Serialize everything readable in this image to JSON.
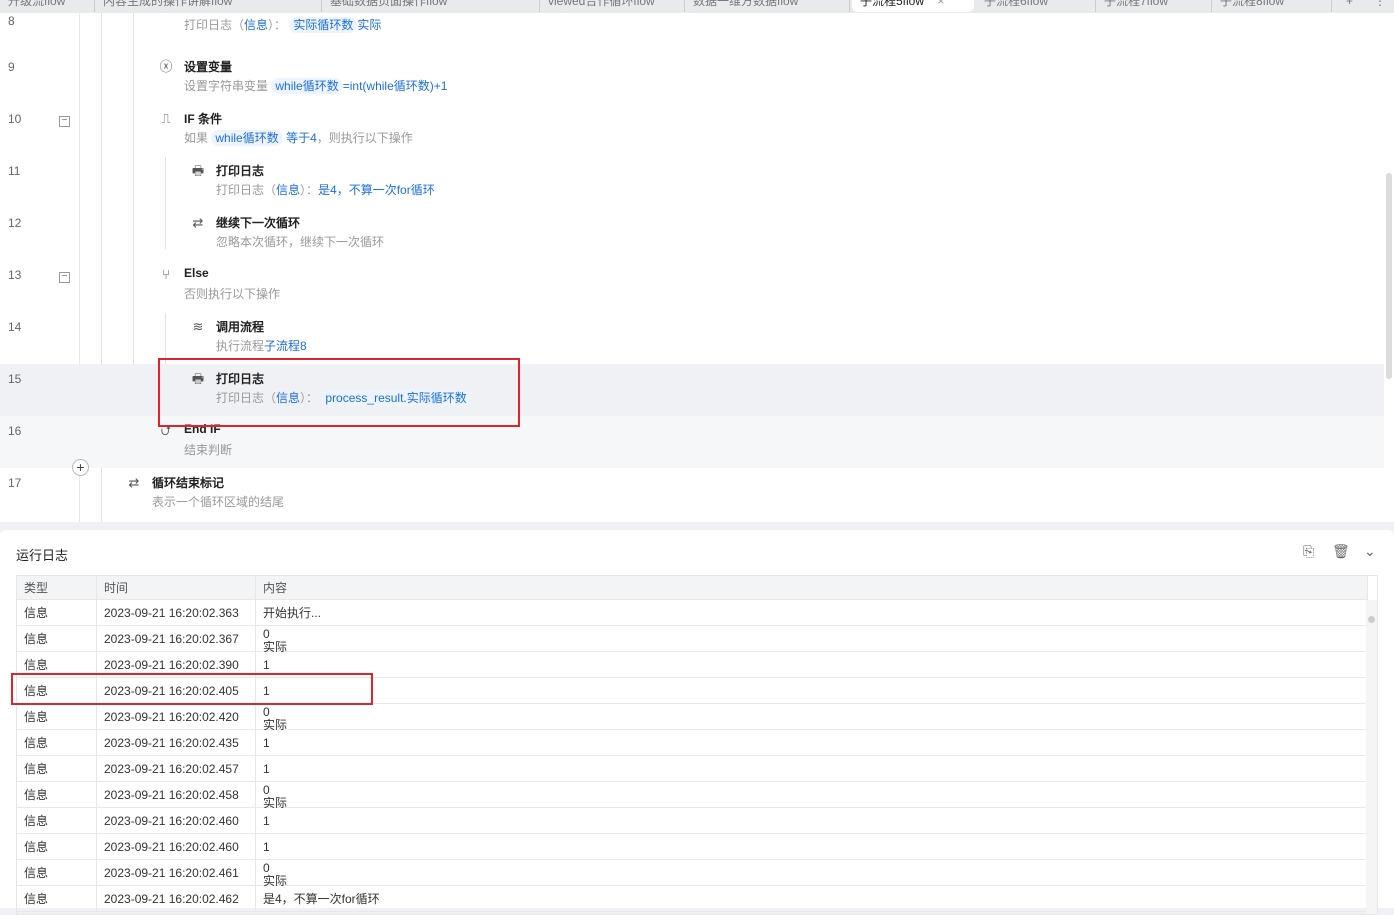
{
  "tabs": [
    {
      "label": "升级流flow"
    },
    {
      "label": "内容生成的操作讲解flow"
    },
    {
      "label": "基础数据页面操作flow"
    },
    {
      "label": "viewed合作循环flow"
    },
    {
      "label": "数据一维方数据flow"
    },
    {
      "label": "子流程5flow",
      "active": true
    },
    {
      "label": "子流程6flow"
    },
    {
      "label": "子流程7flow"
    },
    {
      "label": "子流程8flow"
    }
  ],
  "tab_close": "×",
  "tab_add": "+",
  "tab_more": "⋮",
  "steps": [
    {
      "line": "8",
      "title": "打印日志",
      "desc": "打印日志（",
      "desc_kw": "信息",
      "desc2": "）：",
      "chip": "实际循环数",
      "tail": "实际"
    },
    {
      "line": "9",
      "title": "设置变量",
      "desc": "设置字符串变量",
      "chip": "while循环数",
      "tail": "=int(while循环数)+1"
    },
    {
      "line": "10",
      "title": "IF 条件",
      "desc": "如果",
      "chip": "while循环数",
      "mid": "等于4",
      "tail": "，则执行以下操作",
      "fold": "−"
    },
    {
      "line": "11",
      "title": "打印日志",
      "desc": "打印日志（",
      "desc_kw": "信息",
      "desc2": "）：",
      "tail": "是4，不算一次for循环"
    },
    {
      "line": "12",
      "title": "继续下一次循环",
      "desc": "忽略本次循环，继续下一次循环"
    },
    {
      "line": "13",
      "title": "Else",
      "desc": "否则执行以下操作",
      "fold": "−"
    },
    {
      "line": "14",
      "title": "调用流程",
      "desc": "执行流程",
      "tail": "子流程8"
    },
    {
      "line": "15",
      "title": "打印日志",
      "desc": "打印日志（",
      "desc_kw": "信息",
      "desc2": "）：",
      "chip": "process_result.实际循环数"
    },
    {
      "line": "16",
      "title": "End IF",
      "desc": "结束判断"
    },
    {
      "line": "17",
      "title": "循环结束标记",
      "desc": "表示一个循环区域的结尾"
    }
  ],
  "add_step": "+",
  "log": {
    "title": "运行日志",
    "columns": [
      "类型",
      "时间",
      "内容"
    ],
    "rows": [
      [
        "信息",
        "2023-09-21 16:20:02.363",
        "开始执行..."
      ],
      [
        "信息",
        "2023-09-21 16:20:02.367",
        "0",
        "实际"
      ],
      [
        "信息",
        "2023-09-21 16:20:02.390",
        "1"
      ],
      [
        "信息",
        "2023-09-21 16:20:02.405",
        "1"
      ],
      [
        "信息",
        "2023-09-21 16:20:02.420",
        "0",
        "实际"
      ],
      [
        "信息",
        "2023-09-21 16:20:02.435",
        "1"
      ],
      [
        "信息",
        "2023-09-21 16:20:02.457",
        "1"
      ],
      [
        "信息",
        "2023-09-21 16:20:02.458",
        "0",
        "实际"
      ],
      [
        "信息",
        "2023-09-21 16:20:02.460",
        "1"
      ],
      [
        "信息",
        "2023-09-21 16:20:02.460",
        "1"
      ],
      [
        "信息",
        "2023-09-21 16:20:02.461",
        "0",
        "实际"
      ],
      [
        "信息",
        "2023-09-21 16:20:02.462",
        "是4，不算一次for循环"
      ]
    ]
  },
  "colors": {
    "accent": "#1d6fe0",
    "highlight": "#e0242c"
  }
}
